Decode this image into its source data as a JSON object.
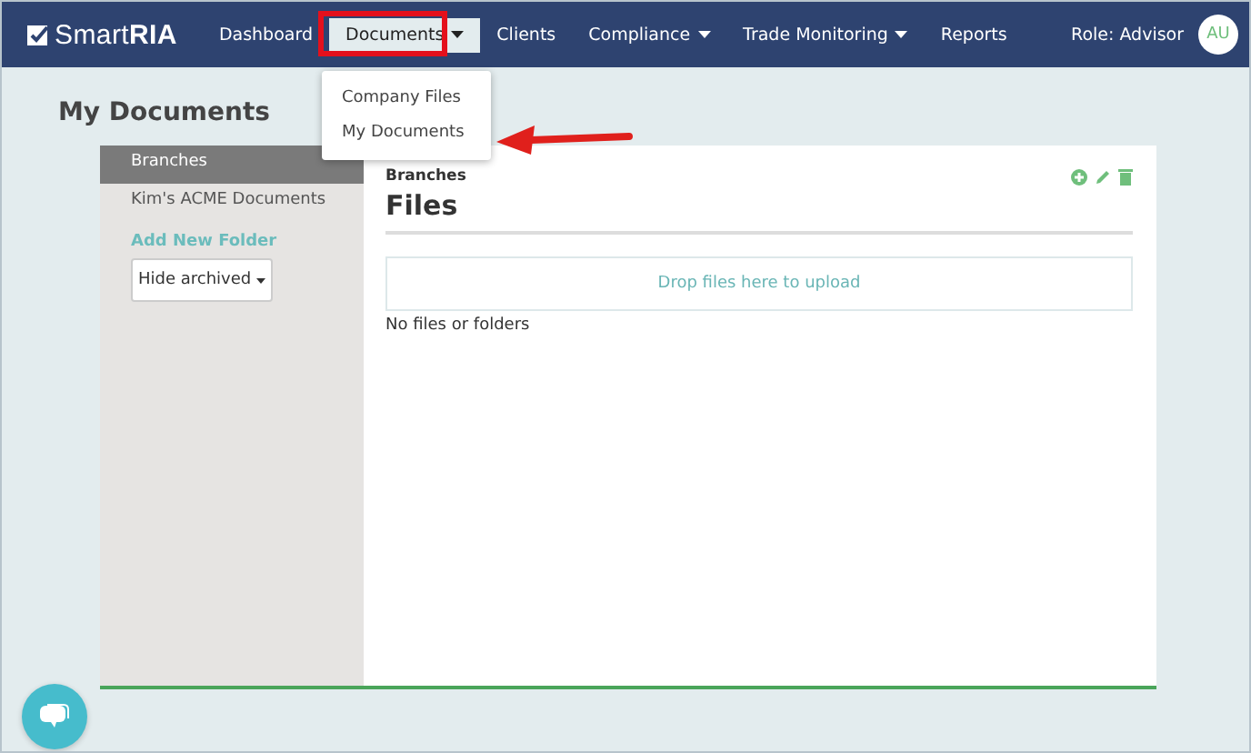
{
  "brand": {
    "name": "Smart",
    "name_bold": "RIA"
  },
  "nav": [
    {
      "label": "Dashboard",
      "dropdown": false,
      "selected": false
    },
    {
      "label": "Documents",
      "dropdown": true,
      "selected": true
    },
    {
      "label": "Clients",
      "dropdown": false,
      "selected": false
    },
    {
      "label": "Compliance",
      "dropdown": true,
      "selected": false
    },
    {
      "label": "Trade Monitoring",
      "dropdown": true,
      "selected": false
    },
    {
      "label": "Reports",
      "dropdown": false,
      "selected": false
    }
  ],
  "role": "Role: Advisor",
  "avatar": "AU",
  "menu": [
    {
      "label": "Company Files",
      "pointed": false
    },
    {
      "label": "My Documents",
      "pointed": true
    }
  ],
  "page_title": "My Documents",
  "sidebar": {
    "items": [
      {
        "label": "Branches",
        "selected": true
      },
      {
        "label": "Kim's ACME Documents",
        "selected": false
      }
    ],
    "add_folder": "Add New Folder",
    "filter": "Hide archived"
  },
  "main": {
    "breadcrumb": "Branches",
    "title": "Files",
    "dropzone": "Drop files here to upload",
    "empty": "No files or folders"
  }
}
